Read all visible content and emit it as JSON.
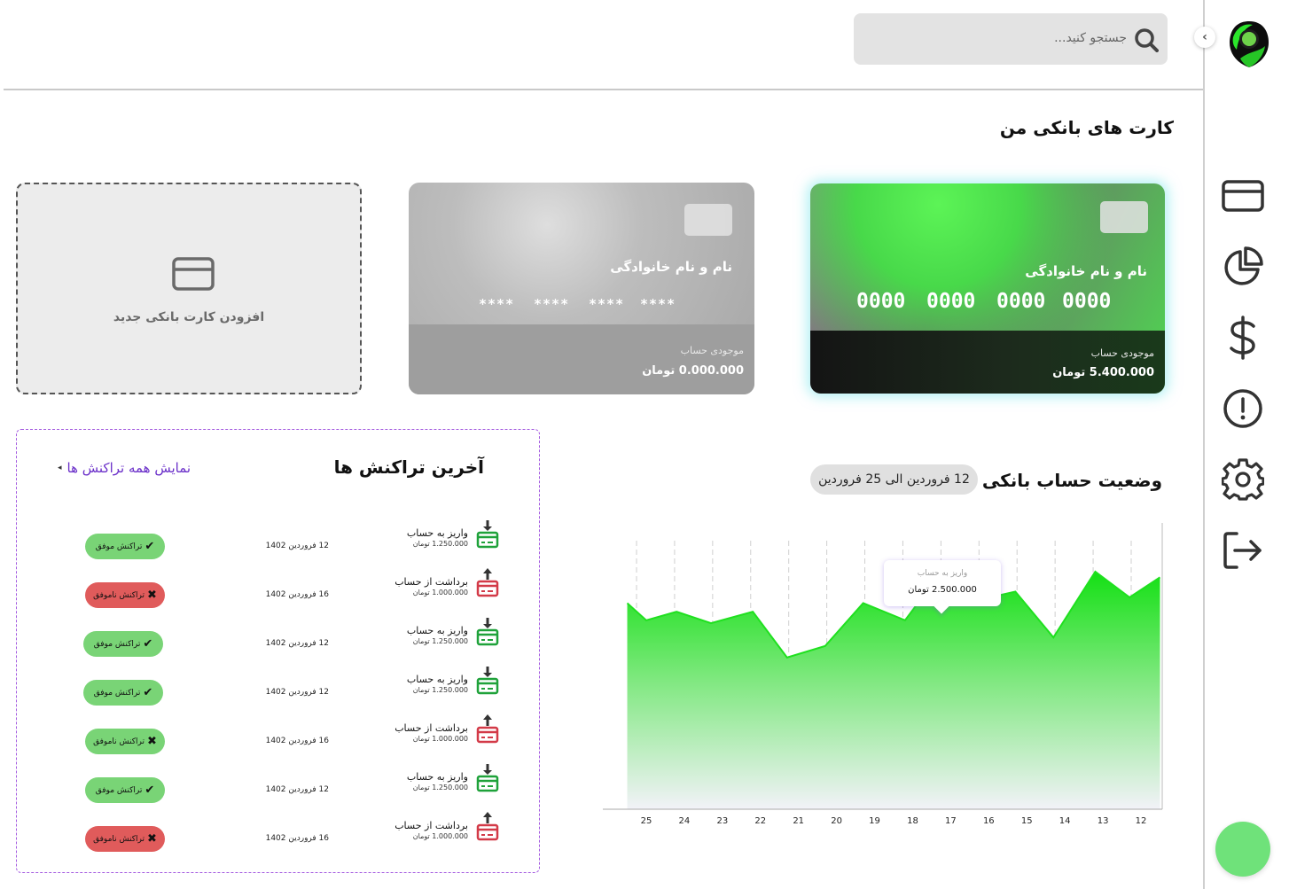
{
  "search": {
    "placeholder": "جستجو کنید..."
  },
  "sidebar": {
    "items": [
      {
        "name": "card-icon"
      },
      {
        "name": "pie-chart-icon"
      },
      {
        "name": "dollar-icon"
      },
      {
        "name": "alert-icon"
      },
      {
        "name": "gear-icon"
      },
      {
        "name": "logout-icon"
      }
    ]
  },
  "cards_section": {
    "title": "کارت های بانکی من",
    "cards": [
      {
        "holder": "نام و نام خانوادگی",
        "number": [
          "0000",
          "0000",
          "0000",
          "0000"
        ],
        "balance_label": "موجودی حساب",
        "balance": "5.400.000 تومان"
      },
      {
        "holder": "نام و نام خانوادگی",
        "number": [
          "****",
          "****",
          "****",
          "****"
        ],
        "balance_label": "موجودی حساب",
        "balance": "0.000.000 تومان"
      }
    ],
    "add_card_label": "افزودن کارت بانکی جدید"
  },
  "account_status": {
    "title": "وضعیت حساب بانکی",
    "date_range": "12 فروردین الی 25 فروردین",
    "tooltip": {
      "label": "واریز به حساب",
      "value": "2.500.000 تومان"
    }
  },
  "chart_data": {
    "type": "area",
    "x": [
      25,
      24,
      23,
      22,
      21,
      20,
      19,
      18,
      17,
      16,
      15,
      14,
      13,
      12
    ],
    "tick_labels": [
      "25",
      "24",
      "23",
      "22",
      "21",
      "20",
      "19",
      "18",
      "17",
      "16",
      "15",
      "14",
      "13",
      "12"
    ],
    "series": [
      {
        "values": [
          72,
          66,
          69,
          65,
          69,
          53,
          57,
          72,
          66,
          82,
          73,
          76,
          60,
          83,
          74,
          81
        ]
      }
    ],
    "points": [
      {
        "x": 25.5,
        "y": 72
      },
      {
        "x": 25,
        "y": 66
      },
      {
        "x": 24.2,
        "y": 69
      },
      {
        "x": 23.3,
        "y": 65
      },
      {
        "x": 22.2,
        "y": 69
      },
      {
        "x": 21.3,
        "y": 53
      },
      {
        "x": 20.3,
        "y": 57
      },
      {
        "x": 19.3,
        "y": 72
      },
      {
        "x": 18.2,
        "y": 66
      },
      {
        "x": 17.3,
        "y": 82
      },
      {
        "x": 16.3,
        "y": 73
      },
      {
        "x": 15.3,
        "y": 76
      },
      {
        "x": 14.3,
        "y": 60
      },
      {
        "x": 13.2,
        "y": 83
      },
      {
        "x": 12.3,
        "y": 74
      },
      {
        "x": 11.5,
        "y": 81
      }
    ],
    "ylim": [
      0,
      100
    ],
    "grid": "vertical-dashed",
    "fill_color": "#1fe01f"
  },
  "transactions": {
    "title": "آخرین تراکنش ها",
    "view_all": "نمایش همه تراکنش ها",
    "rows": [
      {
        "type": "deposit",
        "title": "واریز به حساب",
        "amount": "1.250.000 تومان",
        "date": "12 فروردین 1402",
        "status": "تراکنش موفق",
        "ok": true
      },
      {
        "type": "withdraw",
        "title": "برداشت از حساب",
        "amount": "1.000.000 تومان",
        "date": "16 فروردین 1402",
        "status": "تراکنش ناموفق",
        "ok": false
      },
      {
        "type": "deposit",
        "title": "واریز به حساب",
        "amount": "1.250.000 تومان",
        "date": "12 فروردین 1402",
        "status": "تراکنش موفق",
        "ok": true
      },
      {
        "type": "deposit",
        "title": "واریز به حساب",
        "amount": "1.250.000 تومان",
        "date": "12 فروردین 1402",
        "status": "تراکنش موفق",
        "ok": true
      },
      {
        "type": "withdraw",
        "title": "برداشت از حساب",
        "amount": "1.000.000 تومان",
        "date": "16 فروردین 1402",
        "status": "تراکنش ناموفق",
        "ok": true
      },
      {
        "type": "deposit",
        "title": "واریز به حساب",
        "amount": "1.250.000 تومان",
        "date": "12 فروردین 1402",
        "status": "تراکنش موفق",
        "ok": true
      },
      {
        "type": "withdraw",
        "title": "برداشت از حساب",
        "amount": "1.000.000 تومان",
        "date": "16 فروردین 1402",
        "status": "تراکنش ناموفق",
        "ok": false
      }
    ]
  },
  "colors": {
    "accent": "#3fe04a",
    "success": "#79d476",
    "danger": "#e05b5b",
    "link": "#6a2fc9"
  }
}
